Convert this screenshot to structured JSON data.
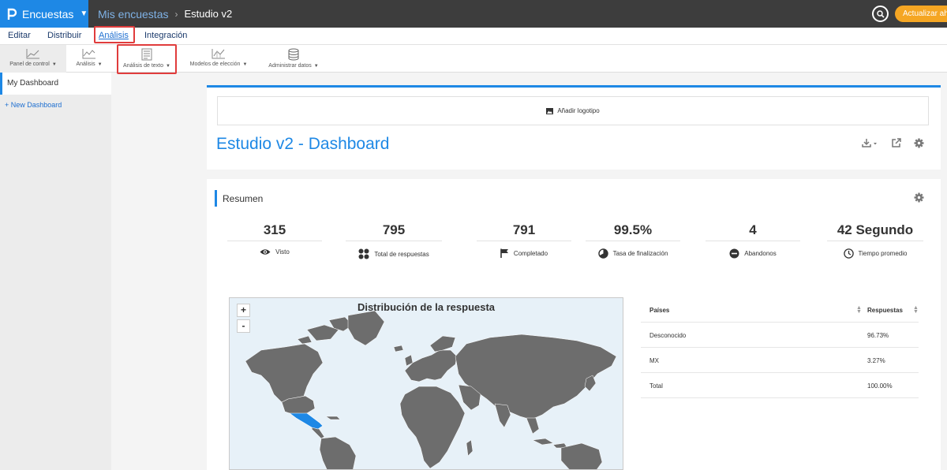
{
  "topbar": {
    "app_label": "Encuestas",
    "breadcrumb": [
      "Mis encuestas",
      "Estudio v2"
    ],
    "upgrade_label": "Actualizar ahora"
  },
  "menu": {
    "items": [
      "Editar",
      "Distribuir",
      "Análisis",
      "Integración"
    ],
    "active": "Análisis"
  },
  "toolbar": {
    "items": [
      "Panel de control",
      "Análisis",
      "Análisis de texto",
      "Modelos de elección",
      "Administrar datos"
    ]
  },
  "sidebar": {
    "active_item": "My Dashboard",
    "new_label": "+ New Dashboard"
  },
  "dashboard": {
    "logo_label": "Añadir logotipo",
    "title": "Estudio v2 - Dashboard"
  },
  "summary": {
    "title": "Resumen",
    "stats": [
      {
        "value": "315",
        "label": "Visto",
        "icon": "eye-icon"
      },
      {
        "value": "795",
        "label": "Total de respuestas",
        "icon": "grid-dots-icon"
      },
      {
        "value": "791",
        "label": "Completado",
        "icon": "flag-icon"
      },
      {
        "value": "99.5%",
        "label": "Tasa de finalización",
        "icon": "pie-icon"
      },
      {
        "value": "4",
        "label": "Abandonos",
        "icon": "minus-circle-icon"
      },
      {
        "value": "42 Segundo",
        "label": "Tiempo promedio",
        "icon": "clock-icon"
      }
    ]
  },
  "map": {
    "title": "Distribución de la respuesta",
    "zoom_in": "+",
    "zoom_out": "-"
  },
  "table": {
    "headers": [
      "Países",
      "Respuestas"
    ],
    "rows": [
      [
        "Desconocido",
        "96.73%"
      ],
      [
        "MX",
        "3.27%"
      ],
      [
        "Total",
        "100.00%"
      ]
    ]
  },
  "colors": {
    "accent": "#1e88e5",
    "topbar": "#3d3d3d",
    "upgrade": "#f5a623",
    "highlight": "#e03c3c",
    "land": "#6d6d6d",
    "mexico": "#1e88e5"
  }
}
